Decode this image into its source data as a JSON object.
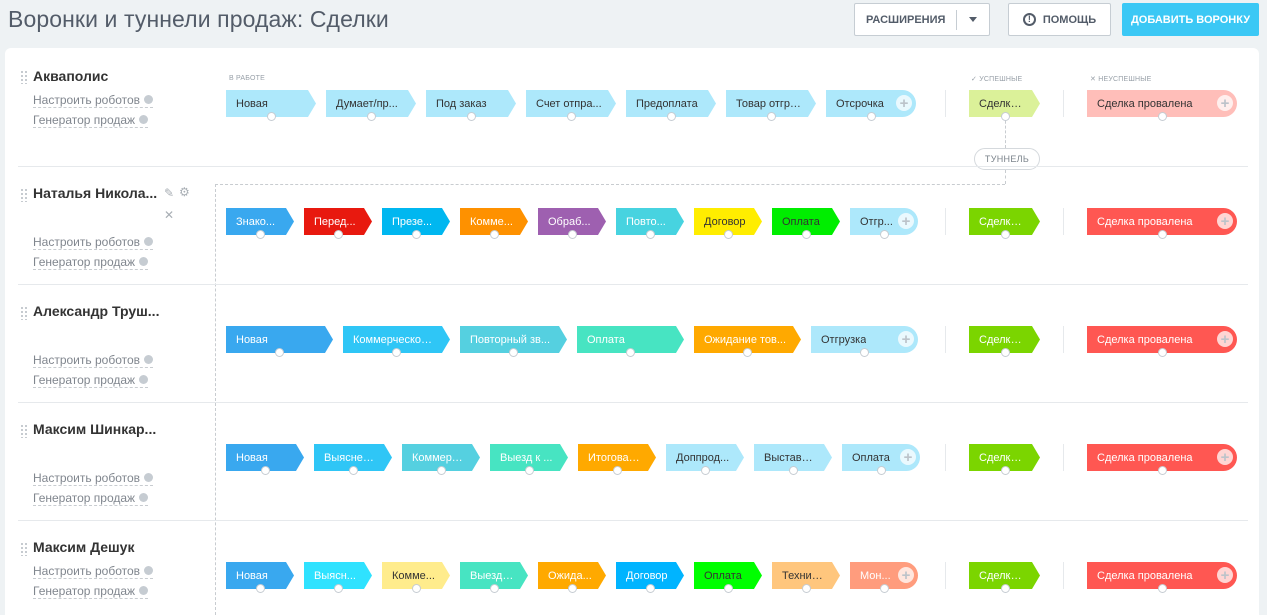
{
  "title": "Воронки и туннели продаж: Сделки",
  "toolbar": {
    "extensions_label": "РАСШИРЕНИЯ",
    "help_label": "ПОМОЩЬ",
    "add_funnel_label": "ДОБАВИТЬ ВОРОНКУ"
  },
  "columns": {
    "in_work": "В РАБОТЕ",
    "success": "УСПЕШНЫЕ",
    "fail": "НЕУСПЕШНЫЕ"
  },
  "tunnel_label": "ТУННЕЛЬ",
  "links": {
    "robots": "Настроить роботов",
    "generator": "Генератор продаж"
  },
  "funnels": [
    {
      "name": "Акваполис",
      "stages": [
        {
          "label": "Новая",
          "color": "#ade8fb"
        },
        {
          "label": "Думает/пр...",
          "color": "#ade8fb"
        },
        {
          "label": "Под заказ",
          "color": "#ade8fb"
        },
        {
          "label": "Счет отпра...",
          "color": "#ade8fb"
        },
        {
          "label": "Предоплата",
          "color": "#ade8fb"
        },
        {
          "label": "Товар отгру...",
          "color": "#ade8fb"
        },
        {
          "label": "Отсрочка",
          "color": "#ade8fb"
        }
      ],
      "success": {
        "label": "Сделка ...",
        "color": "#dbf199"
      },
      "fail": {
        "label": "Сделка провалена",
        "color": "#ffbeb9"
      }
    },
    {
      "name": "Наталья Никола...",
      "stages": [
        {
          "label": "Знако...",
          "color": "#39a8ef"
        },
        {
          "label": "Перед...",
          "color": "#e8190f"
        },
        {
          "label": "Презе...",
          "color": "#00b7f0"
        },
        {
          "label": "Комме...",
          "color": "#fe9100"
        },
        {
          "label": "Обраб...",
          "color": "#9e60b0"
        },
        {
          "label": "Повто...",
          "color": "#47d3e0"
        },
        {
          "label": "Договор",
          "color": "#ffed00"
        },
        {
          "label": "Оплата",
          "color": "#00ee00"
        },
        {
          "label": "Отгр...",
          "color": "#ade8fb"
        }
      ],
      "success": {
        "label": "Сделка ...",
        "color": "#7bd500"
      },
      "fail": {
        "label": "Сделка провалена",
        "color": "#ff5752"
      }
    },
    {
      "name": "Александр Труш...",
      "stages": [
        {
          "label": "Новая",
          "color": "#39a8ef"
        },
        {
          "label": "Коммерческое ...",
          "color": "#2fc6f6"
        },
        {
          "label": "Повторный зв...",
          "color": "#55d0e0"
        },
        {
          "label": "Оплата",
          "color": "#47e4c2"
        },
        {
          "label": "Ожидание тов...",
          "color": "#ffa900"
        },
        {
          "label": "Отгрузка",
          "color": "#ade8fb"
        }
      ],
      "success": {
        "label": "Сделка ...",
        "color": "#7bd500"
      },
      "fail": {
        "label": "Сделка провалена",
        "color": "#ff5752"
      }
    },
    {
      "name": "Максим Шинкар...",
      "stages": [
        {
          "label": "Новая",
          "color": "#39a8ef"
        },
        {
          "label": "Выяснен...",
          "color": "#2fc6f6"
        },
        {
          "label": "Коммерч...",
          "color": "#55d0e0"
        },
        {
          "label": "Выезд к ...",
          "color": "#47e4c2"
        },
        {
          "label": "Итоговая...",
          "color": "#ffa900"
        },
        {
          "label": "Доппрод...",
          "color": "#ade8fb"
        },
        {
          "label": "Выставит...",
          "color": "#ade8fb"
        },
        {
          "label": "Оплата",
          "color": "#ade8fb"
        }
      ],
      "success": {
        "label": "Сделка ...",
        "color": "#7bd500"
      },
      "fail": {
        "label": "Сделка провалена",
        "color": "#ff5752"
      }
    },
    {
      "name": "Максим Дешук",
      "stages": [
        {
          "label": "Новая",
          "color": "#39a8ef"
        },
        {
          "label": "Выясн...",
          "color": "#2fe2ff"
        },
        {
          "label": "Комме...",
          "color": "#ffec8c"
        },
        {
          "label": "Выезд ...",
          "color": "#47e4c2"
        },
        {
          "label": "Ожида...",
          "color": "#ffa900"
        },
        {
          "label": "Договор",
          "color": "#00b4ff"
        },
        {
          "label": "Оплата",
          "color": "#00ff00"
        },
        {
          "label": "Технич...",
          "color": "#ffc67d"
        },
        {
          "label": "Мон...",
          "color": "#ff9c7d"
        }
      ],
      "success": {
        "label": "Сделка ...",
        "color": "#7bd500"
      },
      "fail": {
        "label": "Сделка провалена",
        "color": "#ff5752"
      }
    }
  ]
}
